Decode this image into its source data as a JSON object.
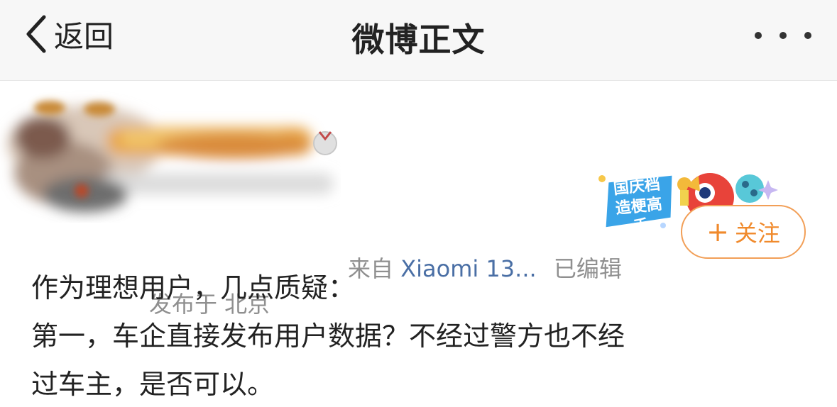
{
  "nav": {
    "back_label": "返回",
    "title": "微博正文",
    "more_icon": "more-dots-icon"
  },
  "post": {
    "source_prefix": "来自",
    "device": "Xiaomi 13...",
    "edited": "已编辑",
    "location": "发布于 北京",
    "badge_text": "国庆档造梗高手",
    "follow_label": "关注",
    "content_lines": [
      "作为理想用户，几点质疑：",
      "第一，车企直接发布用户数据？不经过警方也不经",
      "过车主，是否可以。"
    ]
  },
  "colors": {
    "accent_orange": "#f08a2c",
    "device_blue": "#4a6fa5",
    "meta_gray": "#8f8f8f"
  }
}
